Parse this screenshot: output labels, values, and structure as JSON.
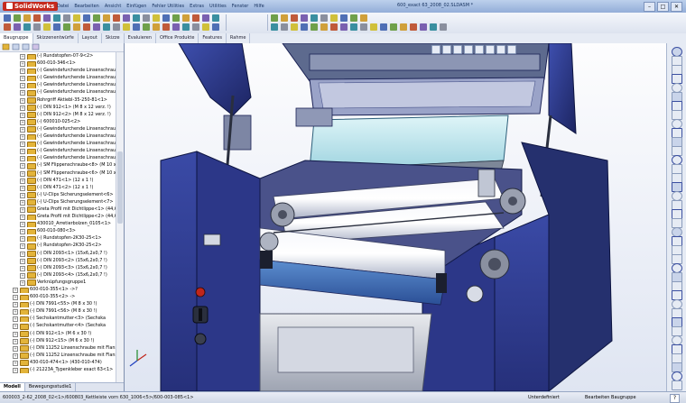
{
  "app": {
    "logo_text": "SolidWorks",
    "title": "600_exact 63_2008_02.SLDASM *"
  },
  "menu": [
    "Datei",
    "Bearbeiten",
    "Ansicht",
    "Einfügen",
    "Fehler Utilities",
    "Extras",
    "Utilities",
    "Fenster",
    "Hilfe"
  ],
  "window_controls": [
    "–",
    "□",
    "✕"
  ],
  "command_tabs": [
    "Baugruppe",
    "Skizzenentwürfe",
    "Layout",
    "Skizze",
    "Evaluieren",
    "Office Produkte",
    "Features",
    "Rahme"
  ],
  "active_command_tab": "Baugruppe",
  "tree": {
    "rows": [
      {
        "indent": 1,
        "label": "(-) Rundstopfen-07-9<2>"
      },
      {
        "indent": 1,
        "label": "600-010-346<1>"
      },
      {
        "indent": 1,
        "label": "(-) Gewindefurchende Linsenschraub"
      },
      {
        "indent": 1,
        "label": "(-) Gewindefurchende Linsenschraub"
      },
      {
        "indent": 1,
        "label": "(-) Gewindefurchende Linsenschraub"
      },
      {
        "indent": 1,
        "label": "(-) Gewindefurchende Linsenschraub"
      },
      {
        "indent": 1,
        "label": "Rohrgriff Aktiebl-35-250-81<1>"
      },
      {
        "indent": 1,
        "label": "(-) DIN 912<1> (M 8 x 12 verz. !)"
      },
      {
        "indent": 1,
        "label": "(-) DIN 912<2> (M 8 x 12 verz. !)"
      },
      {
        "indent": 1,
        "label": "(-) 600010-025<2>"
      },
      {
        "indent": 1,
        "label": "(-) Gewindefurchende Linsenschraub"
      },
      {
        "indent": 1,
        "label": "(-) Gewindefurchende Linsenschraub"
      },
      {
        "indent": 1,
        "label": "(-) Gewindefurchende Linsenschraub"
      },
      {
        "indent": 1,
        "label": "(-) Gewindefurchende Linsenschraub"
      },
      {
        "indent": 1,
        "label": "(-) Gewindefurchende Linsenschraub"
      },
      {
        "indent": 1,
        "label": "(-) SM Flippenschraube<8> (M 10 x"
      },
      {
        "indent": 1,
        "label": "(-) SM Flippenschraube<6> (M 10 x"
      },
      {
        "indent": 1,
        "label": "(-) DIN 471<1> (12 x 1 !)"
      },
      {
        "indent": 1,
        "label": "(-) DIN 471<2> (12 x 1 !)"
      },
      {
        "indent": 1,
        "label": "(-) U-Clips Sicherungselement<6>"
      },
      {
        "indent": 1,
        "label": "(-) U-Clips Sicherungselement<7>"
      },
      {
        "indent": 1,
        "label": "Greta Profil mit Dichtlippe<1> (44,6"
      },
      {
        "indent": 1,
        "label": "Greta Profil mit Dichtlippe<2> (44,6"
      },
      {
        "indent": 1,
        "label": "430010_Arretierbolzen_0105<1>"
      },
      {
        "indent": 1,
        "label": "600-010-080<3>"
      },
      {
        "indent": 1,
        "label": "(-) Rundstopfen-2K30-25<1>"
      },
      {
        "indent": 1,
        "label": "(-) Rundstopfen-2K30-25<2>"
      },
      {
        "indent": 1,
        "label": "(-) DIN 2093<1> (15x6,2x0,7 !)"
      },
      {
        "indent": 1,
        "label": "(-) DIN 2093<2> (15x6,2x0,7 !)"
      },
      {
        "indent": 1,
        "label": "(-) DIN 2093<3> (15x6,2x0,7 !)"
      },
      {
        "indent": 1,
        "label": "(-) DIN 2093<4> (15x6,2x0,7 !)"
      },
      {
        "indent": 1,
        "label": "Verknüpfungsgruppe1"
      },
      {
        "indent": 0,
        "label": "600-010-355<1> ->?"
      },
      {
        "indent": 0,
        "label": "600-010-355<2> ->"
      },
      {
        "indent": 0,
        "label": "(-) DIN 7991<55> (M 8 x 30 !)"
      },
      {
        "indent": 0,
        "label": "(-) DIN 7991<56> (M 8 x 30 !)"
      },
      {
        "indent": 0,
        "label": "(-) Sechskantmutter<3> (Sechska"
      },
      {
        "indent": 0,
        "label": "(-) Sechskantmutter<4> (Sechska"
      },
      {
        "indent": 0,
        "label": "(-) DIN 912<1> (M 6 x 30 !)"
      },
      {
        "indent": 0,
        "label": "(-) DIN 912<15> (M 6 x 30 !)"
      },
      {
        "indent": 0,
        "label": "(-) DIN 11252 Linsenschraube mit Flansch"
      },
      {
        "indent": 0,
        "label": "(-) DIN 11252 Linsenschraube mit Flansch"
      },
      {
        "indent": 0,
        "label": "430-010-474<1> (430-010-474)"
      },
      {
        "indent": 0,
        "label": "(-) 21223A_Typenkleber exact 63<1>"
      }
    ]
  },
  "tree_tabs": [
    "Modell",
    "Bewegungsstudie1"
  ],
  "active_tree_tab": "Modell",
  "status": {
    "left": "600003_2-62_2008_02<1>/600803_Kettleiste vorn 630_1006<5>/600-003-085<1>",
    "mid": "Unterdefiniert",
    "right": "Bearbeiten Baugruppe",
    "help": "?"
  },
  "colors": {
    "accent": "#2e3d8f",
    "frame": "#25306e",
    "titlebar": "#a9c0e4"
  }
}
